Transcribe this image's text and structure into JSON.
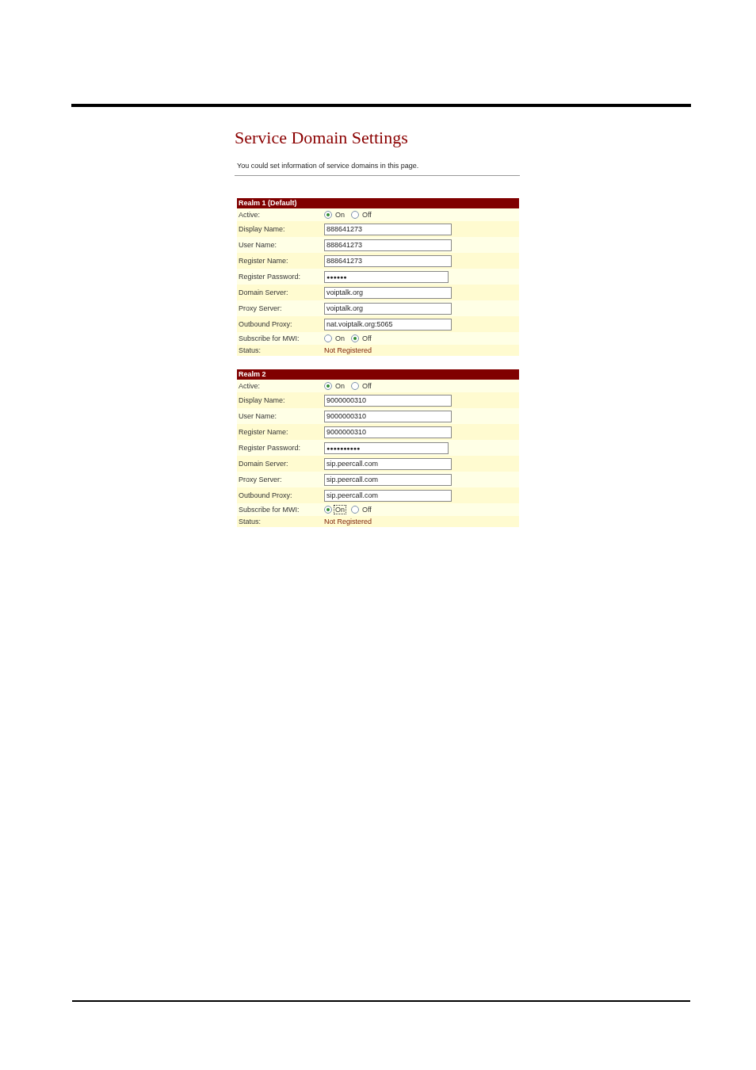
{
  "title": "Service Domain Settings",
  "description": "You could set information of service domains in this page.",
  "realms": [
    {
      "title": "Realm 1 (Default)",
      "fields": [
        {
          "kind": "radio",
          "label": "Active:",
          "options": [
            {
              "label": "On",
              "selected": true,
              "focused": false
            },
            {
              "label": "Off",
              "selected": false,
              "focused": false
            }
          ]
        },
        {
          "kind": "text",
          "label": "Display Name:",
          "value": "888641273"
        },
        {
          "kind": "text",
          "label": "User Name:",
          "value": "888641273"
        },
        {
          "kind": "text",
          "label": "Register Name:",
          "value": "888641273"
        },
        {
          "kind": "password",
          "label": "Register Password:",
          "value": "●●●●●●"
        },
        {
          "kind": "text",
          "label": "Domain Server:",
          "value": "voiptalk.org"
        },
        {
          "kind": "text",
          "label": "Proxy Server:",
          "value": "voiptalk.org"
        },
        {
          "kind": "text",
          "label": "Outbound Proxy:",
          "value": "nat.voiptalk.org:5065"
        },
        {
          "kind": "radio",
          "label": "Subscribe for MWI:",
          "options": [
            {
              "label": "On",
              "selected": false,
              "focused": false
            },
            {
              "label": "Off",
              "selected": true,
              "focused": false
            }
          ]
        },
        {
          "kind": "status",
          "label": "Status:",
          "value": "Not Registered"
        }
      ]
    },
    {
      "title": "Realm 2",
      "fields": [
        {
          "kind": "radio",
          "label": "Active:",
          "options": [
            {
              "label": "On",
              "selected": true,
              "focused": false
            },
            {
              "label": "Off",
              "selected": false,
              "focused": false
            }
          ]
        },
        {
          "kind": "text",
          "label": "Display Name:",
          "value": "9000000310"
        },
        {
          "kind": "text",
          "label": "User Name:",
          "value": "9000000310"
        },
        {
          "kind": "text",
          "label": "Register Name:",
          "value": "9000000310"
        },
        {
          "kind": "password",
          "label": "Register Password:",
          "value": "●●●●●●●●●●"
        },
        {
          "kind": "text",
          "label": "Domain Server:",
          "value": "sip.peercall.com"
        },
        {
          "kind": "text",
          "label": "Proxy Server:",
          "value": "sip.peercall.com"
        },
        {
          "kind": "text",
          "label": "Outbound Proxy:",
          "value": "sip.peercall.com"
        },
        {
          "kind": "radio",
          "label": "Subscribe for MWI:",
          "options": [
            {
              "label": "On",
              "selected": true,
              "focused": true
            },
            {
              "label": "Off",
              "selected": false,
              "focused": false
            }
          ]
        },
        {
          "kind": "status",
          "label": "Status:",
          "value": "Not Registered"
        }
      ]
    }
  ]
}
